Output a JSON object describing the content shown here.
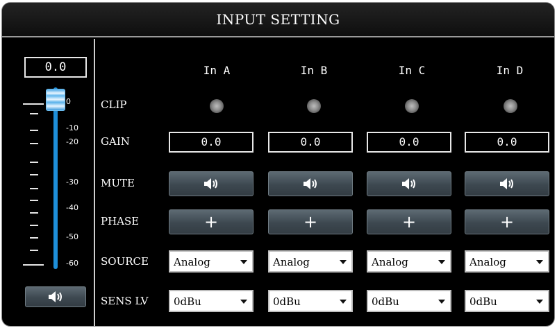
{
  "window": {
    "title": "INPUT SETTING"
  },
  "master": {
    "value": "0.0",
    "fader_level_db": 0,
    "scale_labels": [
      "0",
      "-10",
      "-20",
      "-30",
      "-40",
      "-50",
      "-60"
    ],
    "mute_icon": "speaker-icon"
  },
  "rows": {
    "clip": "CLIP",
    "gain": "GAIN",
    "mute": "MUTE",
    "phase": "PHASE",
    "source": "SOURCE",
    "sens": "SENS LV"
  },
  "channels": [
    {
      "name": "In A",
      "gain": "0.0",
      "phase": "+",
      "source": "Analog",
      "sens": "0dBu"
    },
    {
      "name": "In B",
      "gain": "0.0",
      "phase": "+",
      "source": "Analog",
      "sens": "0dBu"
    },
    {
      "name": "In C",
      "gain": "0.0",
      "phase": "+",
      "source": "Analog",
      "sens": "0dBu"
    },
    {
      "name": "In D",
      "gain": "0.0",
      "phase": "+",
      "source": "Analog",
      "sens": "0dBu"
    }
  ],
  "colors": {
    "fader_blue": "#1e8fd9",
    "button_gray": "#4a555d",
    "background": "#000000"
  }
}
